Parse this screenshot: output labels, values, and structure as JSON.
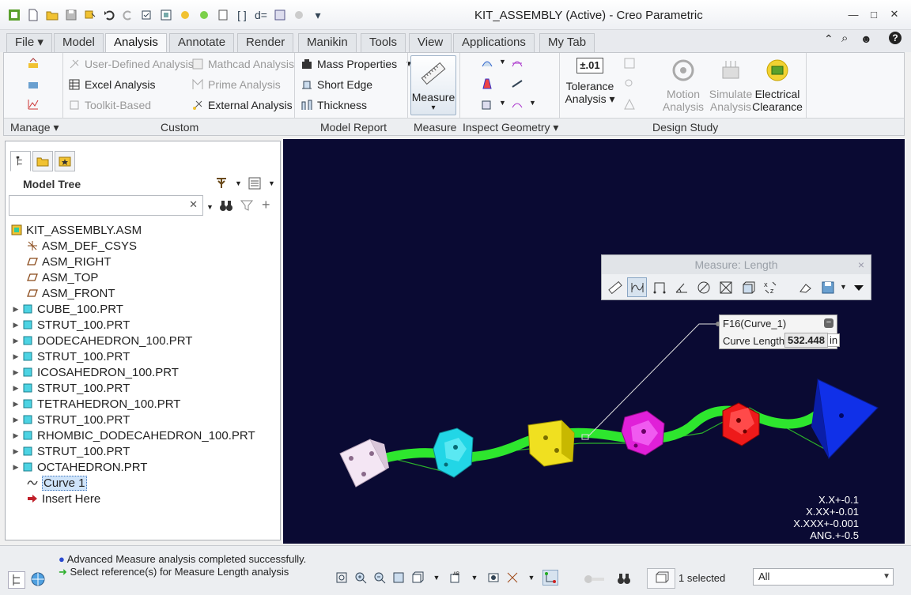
{
  "window": {
    "title": "KIT_ASSEMBLY (Active) - Creo Parametric",
    "controls": {
      "minimize": "—",
      "maximize": "□",
      "close": "✕"
    }
  },
  "quick_access": [
    "new-icon",
    "open-icon",
    "save-icon",
    "regenerate-icon",
    "undo-icon",
    "redo-icon",
    "windows-icon",
    "close-window-icon"
  ],
  "tabs": [
    {
      "label": "File ▾",
      "active": false
    },
    {
      "label": "Model",
      "active": false
    },
    {
      "label": "Analysis",
      "active": true
    },
    {
      "label": "Annotate",
      "active": false
    },
    {
      "label": "Render",
      "active": false
    },
    {
      "label": "Manikin",
      "active": false
    },
    {
      "label": "Tools",
      "active": false
    },
    {
      "label": "View",
      "active": false
    },
    {
      "label": "Applications",
      "active": false
    },
    {
      "label": "My Tab",
      "active": false
    }
  ],
  "ribbon": {
    "custom": {
      "user_defined": "User-Defined Analysis",
      "excel": "Excel Analysis",
      "toolkit": "Toolkit-Based",
      "mathcad": "Mathcad Analysis",
      "prime": "Prime Analysis",
      "external": "External Analysis"
    },
    "model_report": {
      "mass": "Mass Properties",
      "short_edge": "Short Edge",
      "thickness": "Thickness"
    },
    "measure": {
      "label": "Measure",
      "caret": "▾"
    },
    "tolerance": {
      "label": "Tolerance Analysis",
      "icon_text": "±.01",
      "line1": "Tolerance",
      "line2": "Analysis ▾"
    },
    "design_study": {
      "motion": [
        "Motion",
        "Analysis"
      ],
      "simulate": [
        "Simulate",
        "Analysis"
      ],
      "electrical": [
        "Electrical",
        "Clearance"
      ]
    },
    "groups": {
      "manage": "Manage ▾",
      "custom": "Custom",
      "model_report": "Model Report",
      "measure": "Measure",
      "inspect": "Inspect Geometry ▾",
      "design_study": "Design Study"
    }
  },
  "model_tree": {
    "header": "Model Tree",
    "search": {
      "value": "",
      "clear": "✕"
    },
    "items": [
      {
        "label": "KIT_ASSEMBLY.ASM",
        "icon": "assembly-icon",
        "expandable": false,
        "indent": 0
      },
      {
        "label": "ASM_DEF_CSYS",
        "icon": "csys-icon",
        "expandable": false,
        "indent": 1
      },
      {
        "label": "ASM_RIGHT",
        "icon": "datum-plane-icon",
        "expandable": false,
        "indent": 1
      },
      {
        "label": "ASM_TOP",
        "icon": "datum-plane-icon",
        "expandable": false,
        "indent": 1
      },
      {
        "label": "ASM_FRONT",
        "icon": "datum-plane-icon",
        "expandable": false,
        "indent": 1
      },
      {
        "label": "CUBE_100.PRT",
        "icon": "part-icon",
        "expandable": true,
        "indent": 1
      },
      {
        "label": "STRUT_100.PRT",
        "icon": "part-icon",
        "expandable": true,
        "indent": 1
      },
      {
        "label": "DODECAHEDRON_100.PRT",
        "icon": "part-icon",
        "expandable": true,
        "indent": 1
      },
      {
        "label": "STRUT_100.PRT",
        "icon": "part-icon",
        "expandable": true,
        "indent": 1
      },
      {
        "label": "ICOSAHEDRON_100.PRT",
        "icon": "part-icon",
        "expandable": true,
        "indent": 1
      },
      {
        "label": "STRUT_100.PRT",
        "icon": "part-icon",
        "expandable": true,
        "indent": 1
      },
      {
        "label": "TETRAHEDRON_100.PRT",
        "icon": "part-icon",
        "expandable": true,
        "indent": 1
      },
      {
        "label": "STRUT_100.PRT",
        "icon": "part-icon",
        "expandable": true,
        "indent": 1
      },
      {
        "label": "RHOMBIC_DODECAHEDRON_100.PRT",
        "icon": "part-icon",
        "expandable": true,
        "indent": 1
      },
      {
        "label": "STRUT_100.PRT",
        "icon": "part-icon",
        "expandable": true,
        "indent": 1
      },
      {
        "label": "OCTAHEDRON.PRT",
        "icon": "part-icon",
        "expandable": true,
        "indent": 1
      },
      {
        "label": "Curve 1",
        "icon": "curve-icon",
        "expandable": false,
        "indent": 1,
        "selected": true
      },
      {
        "label": "Insert Here",
        "icon": "insert-arrow-icon",
        "expandable": false,
        "indent": 1
      }
    ]
  },
  "measure_dialog": {
    "title": "Measure: Length",
    "close": "×"
  },
  "callout": {
    "title": "F16(Curve_1)",
    "label": "Curve Length",
    "value": "532.448",
    "unit": "in",
    "collapse": "−"
  },
  "tolerances": [
    "X.X+-0.1",
    "X.XX+-0.01",
    "X.XXX+-0.001",
    "ANG.+-0.5"
  ],
  "status": {
    "messages": [
      "Advanced Measure analysis completed successfully.",
      "Select reference(s) for Measure Length analysis"
    ],
    "selected": "1 selected",
    "filter": "All"
  },
  "colors": {
    "viewport_bg": "#0a0a33",
    "strut": "#2ee62e",
    "cube": "#f4e6f4",
    "dodecahedron": "#22d6e6",
    "icosahedron": "#f0e020",
    "rhombic": "#e020d8",
    "octahedron": "#ee1a1a",
    "tetrahedron": "#1030e8"
  }
}
